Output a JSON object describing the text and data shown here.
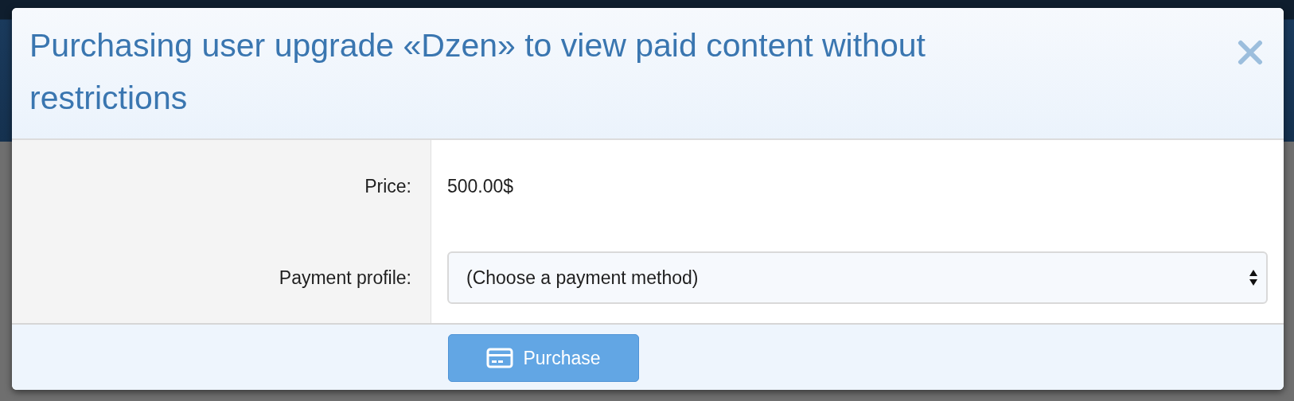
{
  "dialog": {
    "title": "Purchasing user upgrade «Dzen» to view paid content without restrictions",
    "fields": [
      {
        "kind": "text",
        "label": "Price:",
        "value": "500.00$"
      },
      {
        "kind": "select",
        "label": "Payment profile:",
        "value": "(Choose a payment method)"
      }
    ],
    "button": {
      "label": "Purchase",
      "disabled": false
    }
  }
}
